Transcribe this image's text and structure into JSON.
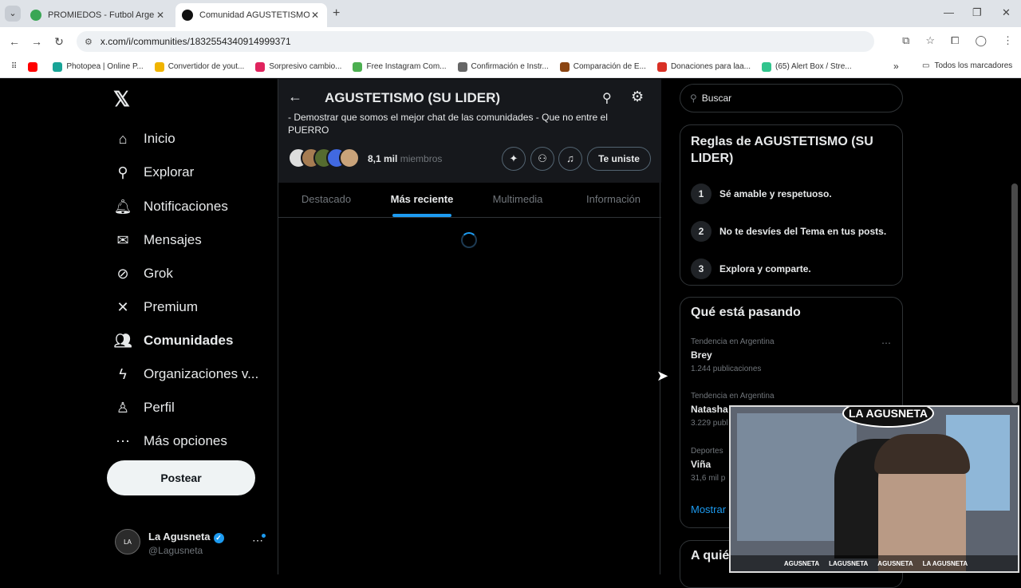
{
  "browser": {
    "tabs": [
      {
        "title": "PROMIEDOS - Futbol Argentino",
        "active": false,
        "fav_color": "#3aa655"
      },
      {
        "title": "Comunidad AGUSTETISMO (SU",
        "active": true,
        "fav_color": "#111111"
      }
    ],
    "url": "x.com/i/communities/1832554340914999371",
    "bookmarks": [
      {
        "label": "",
        "color": "#ff0000"
      },
      {
        "label": "Photopea | Online P...",
        "color": "#18a497"
      },
      {
        "label": "Convertidor de yout...",
        "color": "#f0b400"
      },
      {
        "label": "Sorpresivo cambio...",
        "color": "#e0245e"
      },
      {
        "label": "Free Instagram Com...",
        "color": "#4caf50"
      },
      {
        "label": "Confirmación e Instr...",
        "color": "#666666"
      },
      {
        "label": "Comparación de E...",
        "color": "#8b4513"
      },
      {
        "label": "Donaciones para laa...",
        "color": "#d93025"
      },
      {
        "label": "(65) Alert Box / Stre...",
        "color": "#31c48d"
      }
    ],
    "bookmarks_all": "Todos los marcadores"
  },
  "nav": {
    "items": [
      {
        "label": "Inicio",
        "icon": "home-icon",
        "glyph": "⌂"
      },
      {
        "label": "Explorar",
        "icon": "search-icon",
        "glyph": "⚲"
      },
      {
        "label": "Notificaciones",
        "icon": "bell-icon",
        "glyph": "🔔︎"
      },
      {
        "label": "Mensajes",
        "icon": "mail-icon",
        "glyph": "✉"
      },
      {
        "label": "Grok",
        "icon": "grok-icon",
        "glyph": "⊘"
      },
      {
        "label": "Premium",
        "icon": "x-icon",
        "glyph": "✕"
      },
      {
        "label": "Comunidades",
        "icon": "communities-icon",
        "glyph": "👥︎"
      },
      {
        "label": "Organizaciones v...",
        "icon": "lightning-icon",
        "glyph": "ϟ"
      },
      {
        "label": "Perfil",
        "icon": "person-icon",
        "glyph": "♙"
      },
      {
        "label": "Más opciones",
        "icon": "more-circle-icon",
        "glyph": "⋯"
      }
    ],
    "post_label": "Postear",
    "profile": {
      "name": "La Agusneta",
      "handle": "@Lagusneta"
    }
  },
  "community": {
    "title": "AGUSTETISMO (SU LIDER)",
    "description": "- Demostrar que somos el mejor chat de las comunidades - Que no entre el PUERRO",
    "member_count": "8,1 mil",
    "member_suffix": "miembros",
    "joined_label": "Te uniste",
    "tabs": [
      "Destacado",
      "Más reciente",
      "Multimedia",
      "Información"
    ],
    "active_tab": "Más reciente"
  },
  "sidebar": {
    "search_placeholder": "Buscar",
    "rules_title": "Reglas de AGUSTETISMO (SU LIDER)",
    "rules": [
      {
        "num": "1",
        "text": "Sé amable y respetuoso."
      },
      {
        "num": "2",
        "text": "No te desvíes del Tema en tus posts."
      },
      {
        "num": "3",
        "text": "Explora y comparte."
      }
    ],
    "trends_title": "Qué está pasando",
    "trends": [
      {
        "meta": "Tendencia en Argentina",
        "name": "Brey",
        "count": "1.244 publicaciones"
      },
      {
        "meta": "Tendencia en Argentina",
        "name": "Natasha",
        "count": "3.229 publ"
      },
      {
        "meta": "Deportes",
        "name": "Viña",
        "count": "31,6 mil p"
      }
    ],
    "show_more": "Mostrar",
    "who_title": "A quié"
  },
  "webcam": {
    "logo_text": "LA AGUSNETA",
    "social": [
      "AGUSNETA",
      "LAGUSNETA",
      "AGUSNETA",
      "LA AGUSNETA"
    ]
  }
}
